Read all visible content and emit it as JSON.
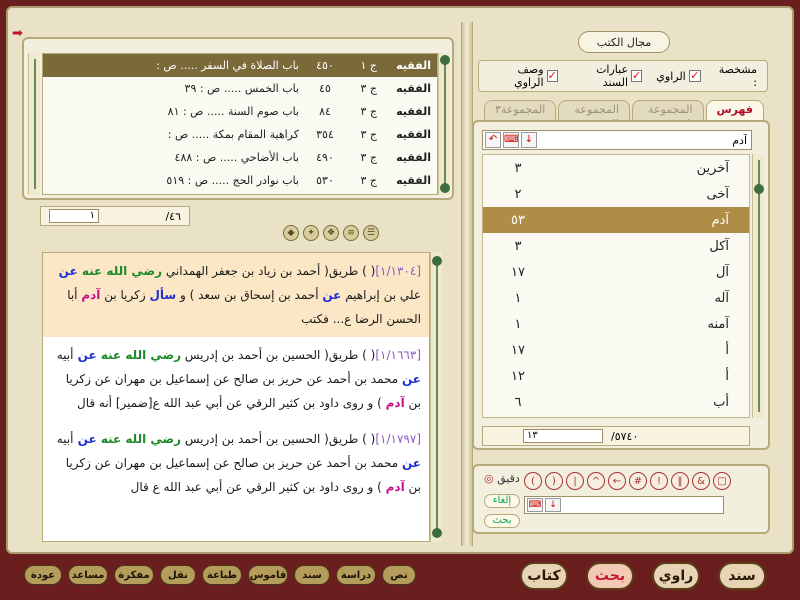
{
  "panel_title": "مجال الكتب",
  "filters": {
    "label": "مشخصة :",
    "options": [
      {
        "label": "الراوي",
        "checked": true
      },
      {
        "label": "عبارات السند",
        "checked": true
      },
      {
        "label": "وصف الراوي",
        "checked": true
      }
    ]
  },
  "tabs": [
    {
      "label": "فهرس",
      "active": true
    },
    {
      "label": "المجموعة ١",
      "active": false
    },
    {
      "label": "المجموعة ٢",
      "active": false
    },
    {
      "label": "المجموعة٣",
      "active": false
    }
  ],
  "search": {
    "value": "آدم"
  },
  "words": [
    {
      "word": "آخرين",
      "count": "٣"
    },
    {
      "word": "آخى",
      "count": "٢"
    },
    {
      "word": "آدم",
      "count": "٥٣",
      "selected": true
    },
    {
      "word": "آكل",
      "count": "٣"
    },
    {
      "word": "آل",
      "count": "١٧"
    },
    {
      "word": "آله",
      "count": "١"
    },
    {
      "word": "آمنه",
      "count": "١"
    },
    {
      "word": "أ",
      "count": "١٧"
    },
    {
      "word": "أ",
      "count": "١٢"
    },
    {
      "word": "أب",
      "count": "٦"
    }
  ],
  "word_counter": {
    "current": "١٣",
    "total": "/٥٧٤٠"
  },
  "index_rows": [
    {
      "cat": "الفقيه",
      "vol": "ج ١",
      "page": "٤٥٠",
      "title": "باب الصلاة في السفر ..... ص :",
      "selected": true
    },
    {
      "cat": "الفقيه",
      "vol": "ج ٣",
      "page": "٤٥",
      "title": "باب الخمس ..... ص : ٣٩"
    },
    {
      "cat": "الفقيه",
      "vol": "ج ٣",
      "page": "٨٤",
      "title": "باب صوم السنة ..... ص : ٨١"
    },
    {
      "cat": "الفقيه",
      "vol": "ج ٣",
      "page": "٣٥٤",
      "title": "كراهية المقام بمكة ..... ص :"
    },
    {
      "cat": "الفقيه",
      "vol": "ج ٣",
      "page": "٤٩٠",
      "title": "باب الأضاحي ..... ص : ٤٨٨"
    },
    {
      "cat": "الفقيه",
      "vol": "ج ٣",
      "page": "٥٣٠",
      "title": "باب نوادر الحج ..... ص : ٥١٩"
    }
  ],
  "index_pager": {
    "current": "١",
    "total": "/٤٦"
  },
  "hadiths": [
    {
      "highlight": true,
      "ref": "[١/١٣٠٤]",
      "p1": "( ) طريق( أحمد بن زياد بن جعفر الهمداني ",
      "g1": "رضي الله عنه",
      "k1": " عن ",
      "p2": "علي بن إبراهيم ",
      "k2": "عن",
      "p3": " أحمد بن إسحاق بن سعد ) و ",
      "k3": "سأل",
      "p4": " زكريا بن ",
      "m1": "آدم",
      "p5": " أبا الحسن الرضا ع... فكتب"
    },
    {
      "highlight": false,
      "ref": "[١/١٦٦٣]",
      "p1": "( ) طريق( الحسين بن أحمد بن إدريس ",
      "g1": "رضي الله عنه",
      "k1": " عن ",
      "p2": "أبيه ",
      "k2": "عن",
      "p3": " محمد بن أحمد عن حريز بن صالح عن إسماعيل بن مهران عن زكريا بن ",
      "k3": "",
      "p4": "",
      "m1": "آدم",
      "p5": " ) و روى داود بن كثير الرقي عن أبي عبد الله ع[ضمير] أنه قال"
    },
    {
      "highlight": false,
      "ref": "[١/١٧٩٧]",
      "p1": "( ) طريق( الحسين بن أحمد بن إدريس ",
      "g1": "رضي الله عنه",
      "k1": " عن ",
      "p2": "أبيه ",
      "k2": "عن",
      "p3": " محمد بن أحمد عن حريز بن صالح عن إسماعيل بن مهران عن زكريا بن ",
      "k3": "",
      "p4": "",
      "m1": "آدم",
      "p5": " ) و روى داود بن كثير الرقي عن أبي عبد الله ع قال"
    }
  ],
  "precise": {
    "label": "دقيق",
    "cancel": "إلغاء",
    "search": "بحث"
  },
  "bottom_nav": [
    "عودة",
    "مساعد",
    "مفكرة",
    "نقل",
    "طباعة",
    "قاموس",
    "سند",
    "دراسة",
    "نص"
  ],
  "bottom_main": [
    {
      "label": "كتاب",
      "active": false
    },
    {
      "label": "بحث",
      "active": true
    },
    {
      "label": "راوي",
      "active": false
    },
    {
      "label": "سند",
      "active": false
    }
  ],
  "colors": {
    "accent": "#c5182a",
    "frame": "#e9e2c7",
    "selection": "#b08d47"
  }
}
